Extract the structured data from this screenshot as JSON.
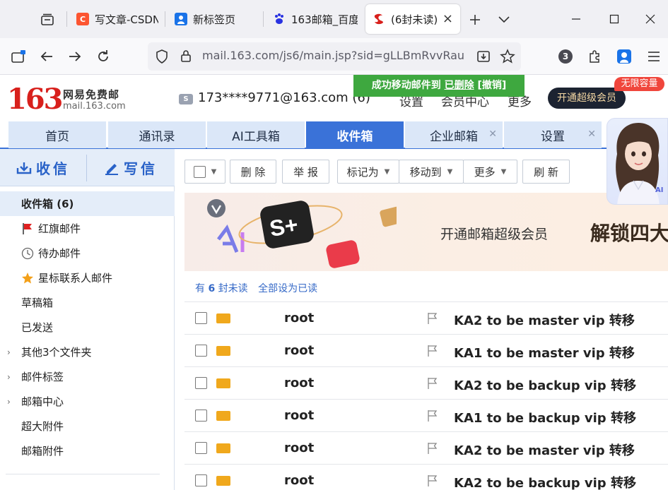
{
  "browser": {
    "tabs": [
      {
        "title": "写文章-CSDN",
        "favicon_color": "#fc5531",
        "favicon_glyph": "C"
      },
      {
        "title": "新标签页",
        "favicon_color": "#1a73e8",
        "favicon_glyph": ""
      },
      {
        "title": "163邮箱_百度",
        "favicon_color": "#2932e1",
        "favicon_glyph": ""
      },
      {
        "title": "(6封未读)",
        "favicon_color": "#d8201c",
        "favicon_glyph": ""
      }
    ],
    "url": "mail.163.com/js6/main.jsp?sid=gLLBmRvvRau",
    "extensions_badge": "3"
  },
  "mail": {
    "logo": {
      "number": "163",
      "name_cn": "网易免费邮",
      "domain": "mail.163.com"
    },
    "account": "173****9771@163.com (6)",
    "account_icon_glyph": "S",
    "header_links": [
      "设置",
      "会员中心",
      "更多"
    ],
    "vip_button": "开通超级会员",
    "vip_badge": "无限容量",
    "toast": {
      "prefix": "成功移动邮件到",
      "link": "已删除",
      "undo": "[撤销]"
    },
    "nav_tabs": [
      "首页",
      "通讯录",
      "AI工具箱",
      "收件箱",
      "企业邮箱",
      "设置"
    ],
    "compose": {
      "receive": "收信",
      "write": "写信"
    },
    "folders": {
      "inbox": "收件箱 (6)",
      "flagged": "红旗邮件",
      "todo": "待办邮件",
      "starred": "星标联系人邮件",
      "drafts": "草稿箱",
      "sent": "已发送",
      "other": "其他3个文件夹",
      "labels": "邮件标签",
      "center": "邮箱中心",
      "large_attach": "超大附件",
      "attachments": "邮箱附件"
    },
    "toolbar": {
      "delete": "删 除",
      "report": "举 报",
      "mark_as": "标记为",
      "move_to": "移动到",
      "more": "更多",
      "refresh": "刷 新"
    },
    "banner": {
      "text": "开通邮箱超级会员",
      "headline": "解锁四大"
    },
    "unread": {
      "prefix": "有",
      "count": "6",
      "suffix": "封未读",
      "mark_all": "全部设为已读"
    },
    "messages": [
      {
        "sender": "root",
        "subject": "KA2 to be master vip 转移"
      },
      {
        "sender": "root",
        "subject": "KA1 to be master vip 转移"
      },
      {
        "sender": "root",
        "subject": "KA2 to be backup vip 转移"
      },
      {
        "sender": "root",
        "subject": "KA1 to be backup vip 转移"
      },
      {
        "sender": "root",
        "subject": "KA2 to be master vip 转移"
      },
      {
        "sender": "root",
        "subject": "KA2 to be backup vip 转移"
      }
    ],
    "ai_label": "AI"
  },
  "colors": {
    "brand_red": "#d8201c",
    "accent_blue": "#3a72d8",
    "toast_green": "#3ea83f"
  }
}
